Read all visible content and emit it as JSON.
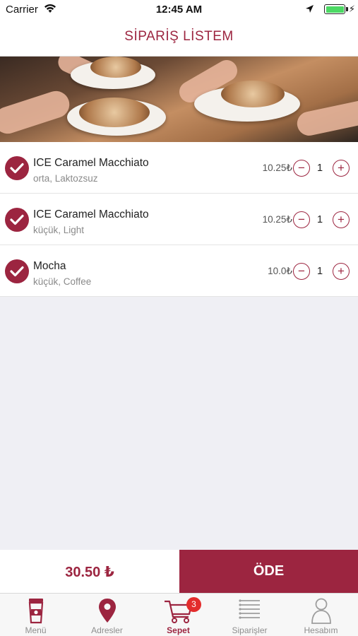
{
  "status_bar": {
    "carrier": "Carrier",
    "time": "12:45 AM"
  },
  "header": {
    "title": "SİPARİŞ LİSTEM"
  },
  "items": [
    {
      "name": "ICE Caramel Macchiato",
      "options": "orta, Laktozsuz",
      "price": "10.25₺",
      "quantity": "1",
      "selected": true
    },
    {
      "name": "ICE Caramel Macchiato",
      "options": "küçük, Light",
      "price": "10.25₺",
      "quantity": "1",
      "selected": true
    },
    {
      "name": "Mocha",
      "options": "küçük, Coffee",
      "price": "10.0₺",
      "quantity": "1",
      "selected": true
    }
  ],
  "controls": {
    "minus": "−",
    "plus": "+"
  },
  "checkout": {
    "total": "30.50 ₺",
    "pay_label": "ÖDE"
  },
  "tabs": [
    {
      "label": "Menü",
      "icon": "coffee-cup-icon",
      "active": false
    },
    {
      "label": "Adresler",
      "icon": "map-pin-icon",
      "active": false
    },
    {
      "label": "Sepet",
      "icon": "cart-icon",
      "active": true,
      "badge": "3"
    },
    {
      "label": "Siparişler",
      "icon": "list-icon",
      "active": false
    },
    {
      "label": "Hesabım",
      "icon": "user-icon",
      "active": false
    }
  ],
  "colors": {
    "brand": "#9c2540",
    "badge": "#e32c2c",
    "background": "#efeff4",
    "battery": "#4cd964"
  }
}
